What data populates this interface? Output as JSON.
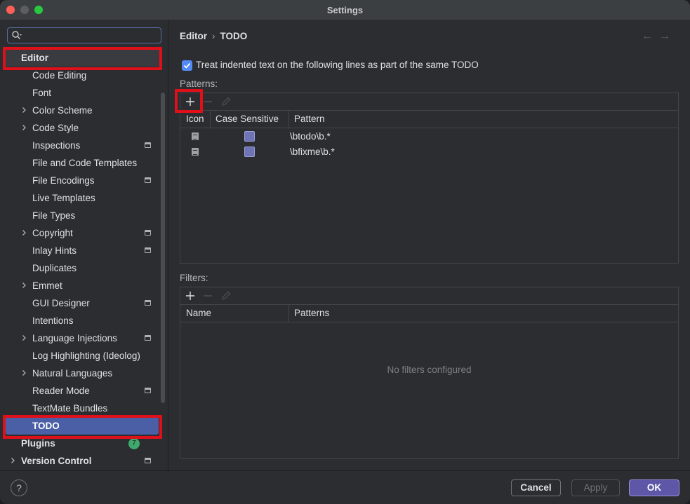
{
  "window": {
    "title": "Settings"
  },
  "sidebar": {
    "search": {
      "placeholder": ""
    },
    "items": [
      {
        "label": "Editor",
        "level": 0,
        "chevron": false,
        "project": false
      },
      {
        "label": "Code Editing",
        "level": 1,
        "chevron": false,
        "project": false
      },
      {
        "label": "Font",
        "level": 1,
        "chevron": false,
        "project": false
      },
      {
        "label": "Color Scheme",
        "level": 1,
        "chevron": true,
        "project": false
      },
      {
        "label": "Code Style",
        "level": 1,
        "chevron": true,
        "project": false
      },
      {
        "label": "Inspections",
        "level": 1,
        "chevron": false,
        "project": true
      },
      {
        "label": "File and Code Templates",
        "level": 1,
        "chevron": false,
        "project": false
      },
      {
        "label": "File Encodings",
        "level": 1,
        "chevron": false,
        "project": true
      },
      {
        "label": "Live Templates",
        "level": 1,
        "chevron": false,
        "project": false
      },
      {
        "label": "File Types",
        "level": 1,
        "chevron": false,
        "project": false
      },
      {
        "label": "Copyright",
        "level": 1,
        "chevron": true,
        "project": true
      },
      {
        "label": "Inlay Hints",
        "level": 1,
        "chevron": false,
        "project": true
      },
      {
        "label": "Duplicates",
        "level": 1,
        "chevron": false,
        "project": false
      },
      {
        "label": "Emmet",
        "level": 1,
        "chevron": true,
        "project": false
      },
      {
        "label": "GUI Designer",
        "level": 1,
        "chevron": false,
        "project": true
      },
      {
        "label": "Intentions",
        "level": 1,
        "chevron": false,
        "project": false
      },
      {
        "label": "Language Injections",
        "level": 1,
        "chevron": true,
        "project": true
      },
      {
        "label": "Log Highlighting (Ideolog)",
        "level": 1,
        "chevron": false,
        "project": false
      },
      {
        "label": "Natural Languages",
        "level": 1,
        "chevron": true,
        "project": false
      },
      {
        "label": "Reader Mode",
        "level": 1,
        "chevron": false,
        "project": true
      },
      {
        "label": "TextMate Bundles",
        "level": 1,
        "chevron": false,
        "project": false
      },
      {
        "label": "TODO",
        "level": 1,
        "chevron": false,
        "project": false,
        "selected": true
      },
      {
        "label": "Plugins",
        "level": 0,
        "chevron": false,
        "project": false,
        "badge": "7"
      },
      {
        "label": "Version Control",
        "level": 0,
        "chevron": true,
        "project": true
      }
    ]
  },
  "breadcrumb": {
    "parent": "Editor",
    "separator": "›",
    "current": "TODO"
  },
  "options": {
    "treat_indented_label": "Treat indented text on the following lines as part of the same TODO",
    "treat_indented_checked": true
  },
  "patterns": {
    "label": "Patterns:",
    "columns": [
      "Icon",
      "Case Sensitive",
      "Pattern"
    ],
    "rows": [
      {
        "icon": "todo-icon",
        "case_sensitive": false,
        "pattern": "\\btodo\\b.*"
      },
      {
        "icon": "todo-icon",
        "case_sensitive": false,
        "pattern": "\\bfixme\\b.*"
      }
    ]
  },
  "filters": {
    "label": "Filters:",
    "columns": [
      "Name",
      "Patterns"
    ],
    "empty_text": "No filters configured"
  },
  "footer": {
    "help_label": "?",
    "cancel_label": "Cancel",
    "apply_label": "Apply",
    "ok_label": "OK"
  },
  "colors": {
    "accent": "#548af7",
    "selection": "#4a5fa6",
    "ok_button": "#5e57a8",
    "highlight_box": "#e0101a",
    "badge": "#3fa86b"
  }
}
